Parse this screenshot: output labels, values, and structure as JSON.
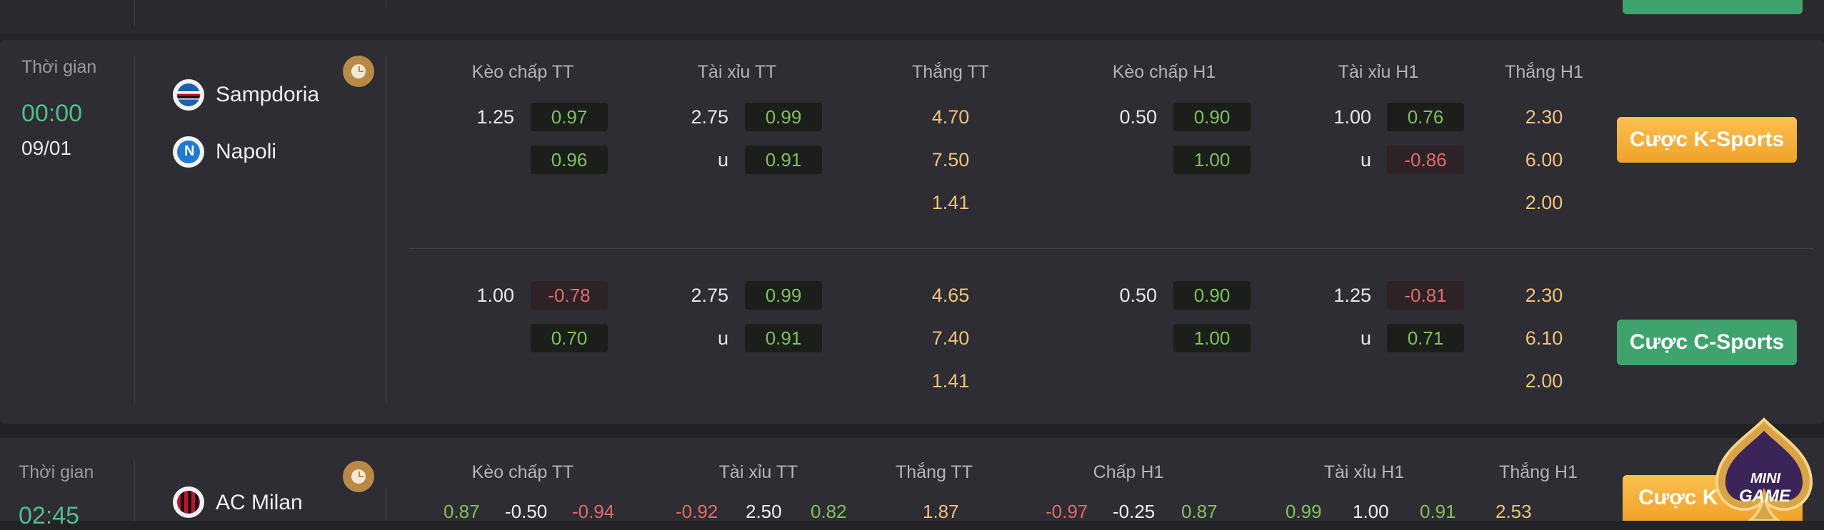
{
  "top_panel": {
    "button_label": ""
  },
  "match1": {
    "time_label": "Thời gian",
    "time": "00:00",
    "date": "09/01",
    "home_team": "Sampdoria",
    "away_team": "Napoli",
    "headers": [
      "Kèo chấp TT",
      "Tài xỉu TT",
      "Thắng TT",
      "Kèo chấp H1",
      "Tài xỉu H1",
      "Thắng H1"
    ],
    "ksports": {
      "handicap_tt_line": "1.25",
      "handicap_tt_home": "0.97",
      "handicap_tt_away": "0.96",
      "ou_tt_line": "2.75",
      "ou_tt_over": "0.99",
      "ou_tt_under_label": "u",
      "ou_tt_under": "0.91",
      "win_tt": [
        "4.70",
        "7.50",
        "1.41"
      ],
      "handicap_h1_line": "0.50",
      "handicap_h1_home": "0.90",
      "handicap_h1_away": "1.00",
      "ou_h1_line": "1.00",
      "ou_h1_over": "0.76",
      "ou_h1_under_label": "u",
      "ou_h1_under": "-0.86",
      "win_h1": [
        "2.30",
        "6.00",
        "2.00"
      ],
      "button": "Cược K-Sports"
    },
    "csports": {
      "handicap_tt_line": "1.00",
      "handicap_tt_home": "-0.78",
      "handicap_tt_away": "0.70",
      "ou_tt_line": "2.75",
      "ou_tt_over": "0.99",
      "ou_tt_under_label": "u",
      "ou_tt_under": "0.91",
      "win_tt": [
        "4.65",
        "7.40",
        "1.41"
      ],
      "handicap_h1_line": "0.50",
      "handicap_h1_home": "0.90",
      "handicap_h1_away": "1.00",
      "ou_h1_line": "1.25",
      "ou_h1_over": "-0.81",
      "ou_h1_under_label": "u",
      "ou_h1_under": "0.71",
      "win_h1": [
        "2.30",
        "6.10",
        "2.00"
      ],
      "button": "Cược C-Sports"
    }
  },
  "match2": {
    "time_label": "Thời gian",
    "time": "02:45",
    "home_team": "AC Milan",
    "headers": [
      "Kèo chấp TT",
      "Tài xỉu TT",
      "Thắng TT",
      "Chấp H1",
      "Tài xỉu H1",
      "Thắng H1"
    ],
    "row": [
      "0.87",
      "-0.50",
      "-0.94",
      "-0.92",
      "2.50",
      "0.82",
      "1.87",
      "-0.97",
      "-0.25",
      "0.87",
      "0.99",
      "1.00",
      "0.91",
      "2.53"
    ],
    "button": "Cược K",
    "badge_line1": "MINI",
    "badge_line2": "GAME"
  },
  "colors": {
    "green": "#4ec08b",
    "odd_green": "#7fc25a",
    "odd_red": "#e06a6a",
    "gold": "#f0c27a",
    "orange_button": "#f5ad33",
    "green_button": "#3fa36e"
  }
}
